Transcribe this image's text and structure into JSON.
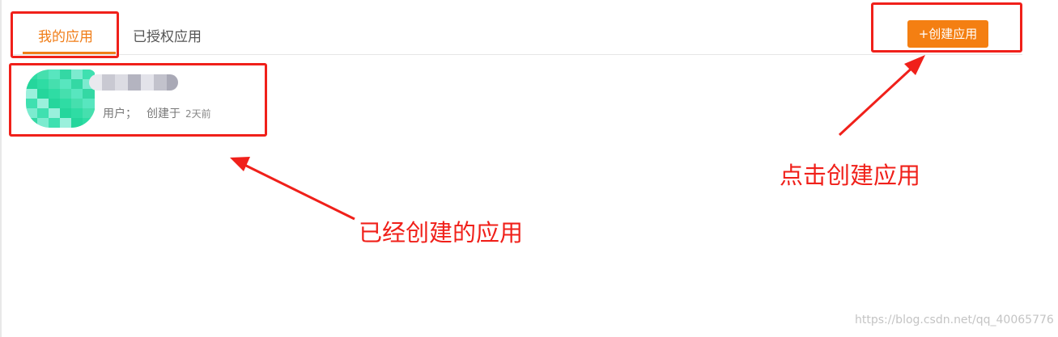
{
  "tabs": {
    "active_label": "我的应用",
    "inactive_label": "已授权应用"
  },
  "create_button": {
    "label": "+创建应用"
  },
  "app_card": {
    "meta_users": "用户；",
    "meta_created": "创建于",
    "meta_time": "2天前"
  },
  "annotations": {
    "create": "点击创建应用",
    "existing": "已经创建的应用"
  },
  "watermark": "https://blog.csdn.net/qq_40065776",
  "colors": {
    "accent": "#f07d17",
    "button": "#f47f12",
    "annotation_red": "#f0201a",
    "avatar_green": "#2fdca4"
  }
}
